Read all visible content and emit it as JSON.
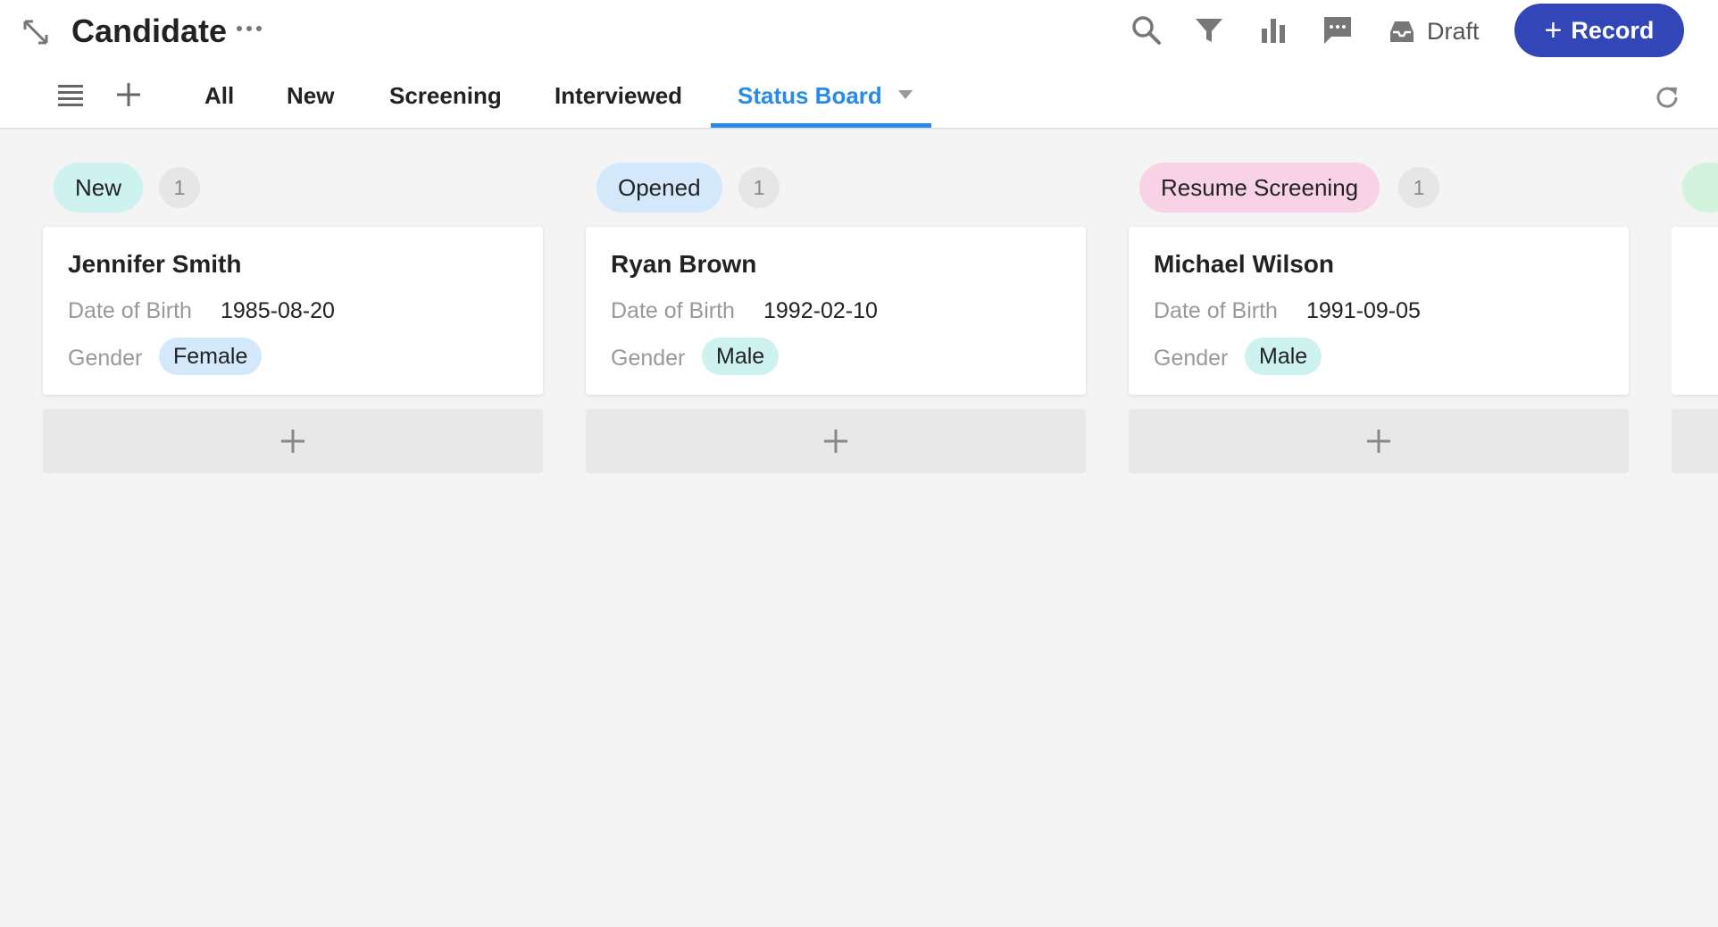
{
  "header": {
    "title": "Candidate",
    "draft_label": "Draft",
    "record_button_label": "Record"
  },
  "tabs": [
    {
      "label": "All"
    },
    {
      "label": "New"
    },
    {
      "label": "Screening"
    },
    {
      "label": "Interviewed"
    },
    {
      "label": "Status Board",
      "active": true
    }
  ],
  "board": {
    "columns": [
      {
        "status": "New",
        "color": "#cdf2ef",
        "count": "1",
        "card": {
          "name": "Jennifer Smith",
          "dob_label": "Date of Birth",
          "dob": "1985-08-20",
          "gender_label": "Gender",
          "gender": "Female",
          "gender_color": "#d4e8fb"
        }
      },
      {
        "status": "Opened",
        "color": "#d4e8fb",
        "count": "1",
        "card": {
          "name": "Ryan Brown",
          "dob_label": "Date of Birth",
          "dob": "1992-02-10",
          "gender_label": "Gender",
          "gender": "Male",
          "gender_color": "#cdf2ef"
        }
      },
      {
        "status": "Resume Screening",
        "color": "#f8d3e6",
        "count": "1",
        "card": {
          "name": "Michael Wilson",
          "dob_label": "Date of Birth",
          "dob": "1991-09-05",
          "gender_label": "Gender",
          "gender": "Male",
          "gender_color": "#cdf2ef"
        }
      }
    ],
    "partial_column_color": "#d3f3dc"
  },
  "colors": {
    "accent": "#2a8ae8",
    "record_button": "#3346b8"
  }
}
